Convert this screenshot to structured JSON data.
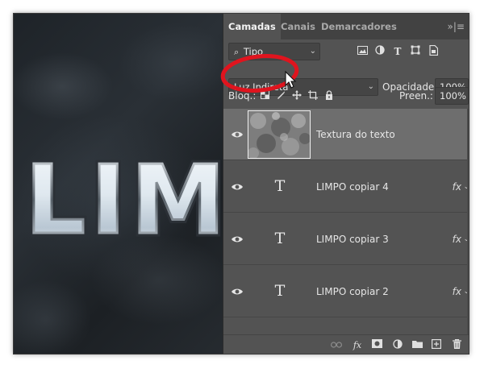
{
  "canvas": {
    "text": "LIM"
  },
  "tabs": [
    {
      "label": "Camadas",
      "active": true
    },
    {
      "label": "Canais",
      "active": false
    },
    {
      "label": "Demarcadores",
      "active": false
    }
  ],
  "tab_menu": "»|≡",
  "filter": {
    "kind_label": "Tipo",
    "icons": [
      "image-filter-icon",
      "adjustment-filter-icon",
      "type-filter-icon",
      "shape-filter-icon",
      "smart-object-filter-icon"
    ]
  },
  "blend": {
    "mode": "Luz Indireta",
    "opacity_label": "Opacidade:",
    "opacity_value": "100%"
  },
  "lock": {
    "label": "Bloq.:",
    "fill_label": "Preen.:",
    "fill_value": "100%"
  },
  "layers": [
    {
      "name": "Textura do texto",
      "type": "image",
      "selected": true,
      "fx": ""
    },
    {
      "name": "LIMPO copiar 4",
      "type": "text",
      "selected": false,
      "fx": "fx"
    },
    {
      "name": "LIMPO copiar 3",
      "type": "text",
      "selected": false,
      "fx": "fx"
    },
    {
      "name": "LIMPO copiar 2",
      "type": "text",
      "selected": false,
      "fx": "fx"
    }
  ],
  "type_glyph": "T",
  "colors": {
    "panel_bg": "#535353",
    "selected_layer": "#6e6e6e",
    "annotation_red": "#e0141e"
  }
}
